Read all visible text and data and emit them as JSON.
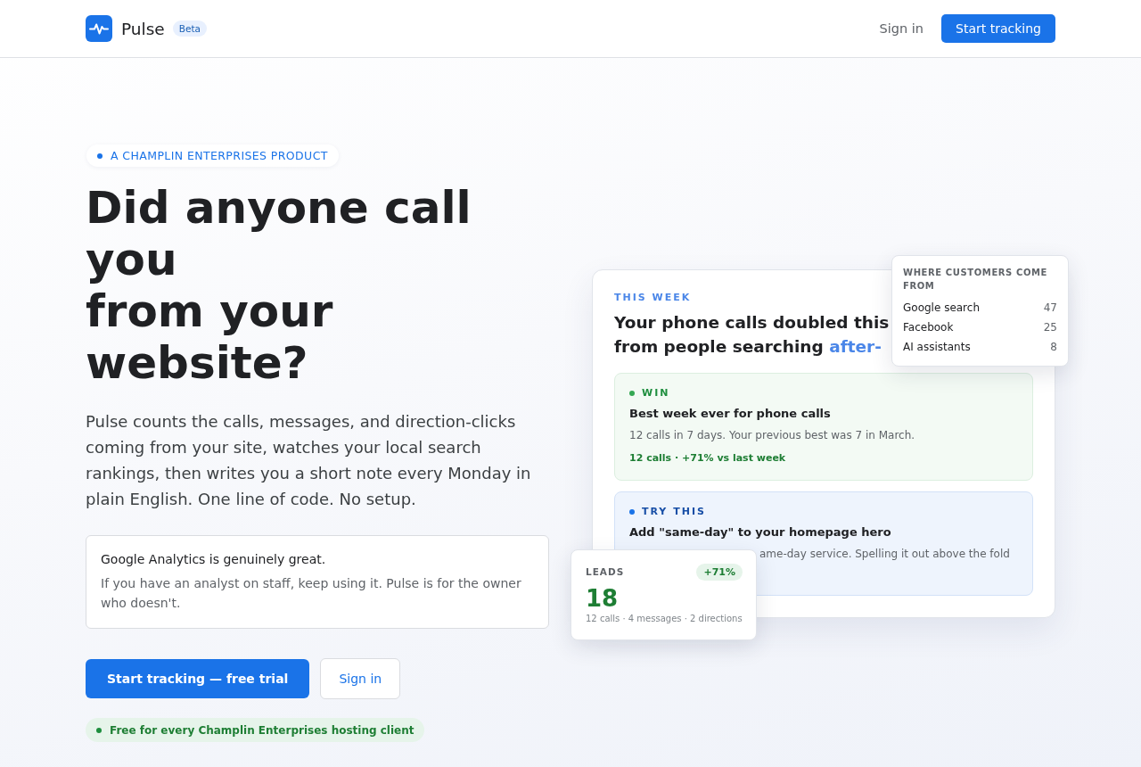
{
  "nav": {
    "brand": "Pulse",
    "badge": "Beta",
    "sign_in": "Sign in",
    "cta": "Start tracking"
  },
  "hero": {
    "eyebrow": "A CHAMPLIN ENTERPRISES PRODUCT",
    "title_lines": [
      "Did anyone call you",
      "from your website?"
    ],
    "lead": "Pulse counts the calls, messages, and direction-clicks coming from your site, watches your local search rankings, then writes you a short note every Monday in plain English. One line of code. No setup.",
    "note": {
      "title": "Google Analytics is genuinely great.",
      "body": "If you have an analyst on staff, keep using it. Pulse is for the owner who doesn't."
    },
    "actions": [
      {
        "label": "Start tracking — free trial",
        "kind": "primary"
      },
      {
        "label": "Sign in",
        "kind": "secondary"
      }
    ],
    "perk": "Free for every Champlin Enterprises hosting client"
  },
  "report_card": {
    "eyebrow": "THIS WEEK",
    "headline_lines": [
      "Your phone calls doubled this",
      "from people searching"
    ],
    "headline_highlight": "after-",
    "insights": [
      {
        "kind": "win",
        "label": "WIN",
        "title": "Best week ever for phone calls",
        "body": "12 calls in 7 days. Your previous best was 7 in March.",
        "stat": "12 calls · +71% vs last week"
      },
      {
        "kind": "tip",
        "label": "TRY THIS",
        "title": "Add \"same-day\" to your homepage hero",
        "body": "ame-day service. Spelling it out above the fold"
      }
    ]
  },
  "sources_card": {
    "title": "WHERE CUSTOMERS COME FROM",
    "rows": [
      {
        "name": "Google search",
        "count": "47"
      },
      {
        "name": "Facebook",
        "count": "25"
      },
      {
        "name": "AI assistants",
        "count": "8"
      }
    ]
  },
  "leads_card": {
    "label": "LEADS",
    "change": "+71%",
    "value": "18",
    "breakdown": "12 calls · 4 messages · 2 directions"
  }
}
